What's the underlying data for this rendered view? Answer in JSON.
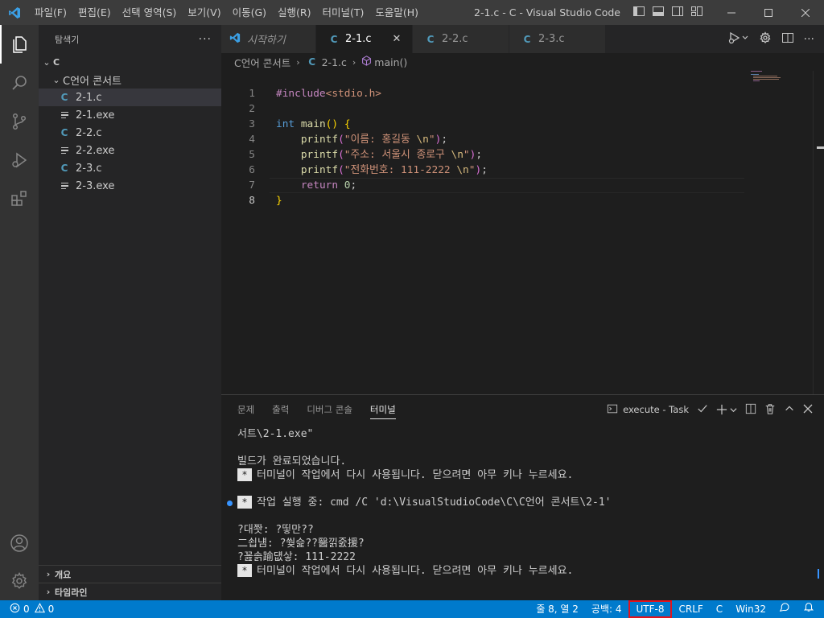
{
  "window": {
    "title": "2-1.c - C - Visual Studio Code"
  },
  "menu": [
    "파일(F)",
    "편집(E)",
    "선택 영역(S)",
    "보기(V)",
    "이동(G)",
    "실행(R)",
    "터미널(T)",
    "도움말(H)"
  ],
  "explorer": {
    "title": "탐색기",
    "root": "C",
    "folder": "C언어 콘서트",
    "files": [
      {
        "name": "2-1.c",
        "kind": "c",
        "selected": true
      },
      {
        "name": "2-1.exe",
        "kind": "exe"
      },
      {
        "name": "2-2.c",
        "kind": "c"
      },
      {
        "name": "2-2.exe",
        "kind": "exe"
      },
      {
        "name": "2-3.c",
        "kind": "c"
      },
      {
        "name": "2-3.exe",
        "kind": "exe"
      }
    ],
    "sections": [
      "개요",
      "타임라인"
    ]
  },
  "tabs": [
    {
      "label": "시작하기",
      "kind": "vscode"
    },
    {
      "label": "2-1.c",
      "kind": "c",
      "active": true
    },
    {
      "label": "2-2.c",
      "kind": "c"
    },
    {
      "label": "2-3.c",
      "kind": "c"
    }
  ],
  "breadcrumb": {
    "folder": "C언어 콘서트",
    "file": "2-1.c",
    "symbol": "main()"
  },
  "code": {
    "current_line": 8,
    "lines": [
      "#include<stdio.h>",
      "",
      "int main() {",
      "    printf(\"이름: 홍길동 \\n\");",
      "    printf(\"주소: 서울시 종로구 \\n\");",
      "    printf(\"전화번호: 111-2222 \\n\");",
      "    return 0;",
      "}"
    ]
  },
  "panel": {
    "tabs": [
      "문제",
      "출력",
      "디버그 콘솔",
      "터미널"
    ],
    "active_tab": "터미널",
    "task_label": "execute - Task"
  },
  "terminal": {
    "lines": [
      "서트\\2-1.exe\"",
      "",
      "빌드가 완료되었습니다.",
      "터미널이 작업에서 다시 사용됩니다. 닫으려면 아무 키나 누르세요.",
      "",
      "작업 실행 중: cmd /C 'd:\\VisualStudioCode\\C\\C언어 콘서트\\2-1'",
      "",
      "?대쫫: ?띻만??",
      "二쇱냼: ?쒖슱??醫낅줈援?",
      "?꾪솕踰덊샇: 111-2222",
      "터미널이 작업에서 다시 사용됩니다. 닫으려면 아무 키나 누르세요."
    ],
    "star_glyph": "*"
  },
  "statusbar": {
    "errors": "0",
    "warnings": "0",
    "position": "줄 8, 열 2",
    "spaces": "공백: 4",
    "encoding": "UTF-8",
    "eol": "CRLF",
    "language": "C",
    "platform": "Win32"
  },
  "colors": {
    "accent": "#007acc",
    "highlight_box": "#e0141e",
    "c_icon": "#519aba"
  }
}
